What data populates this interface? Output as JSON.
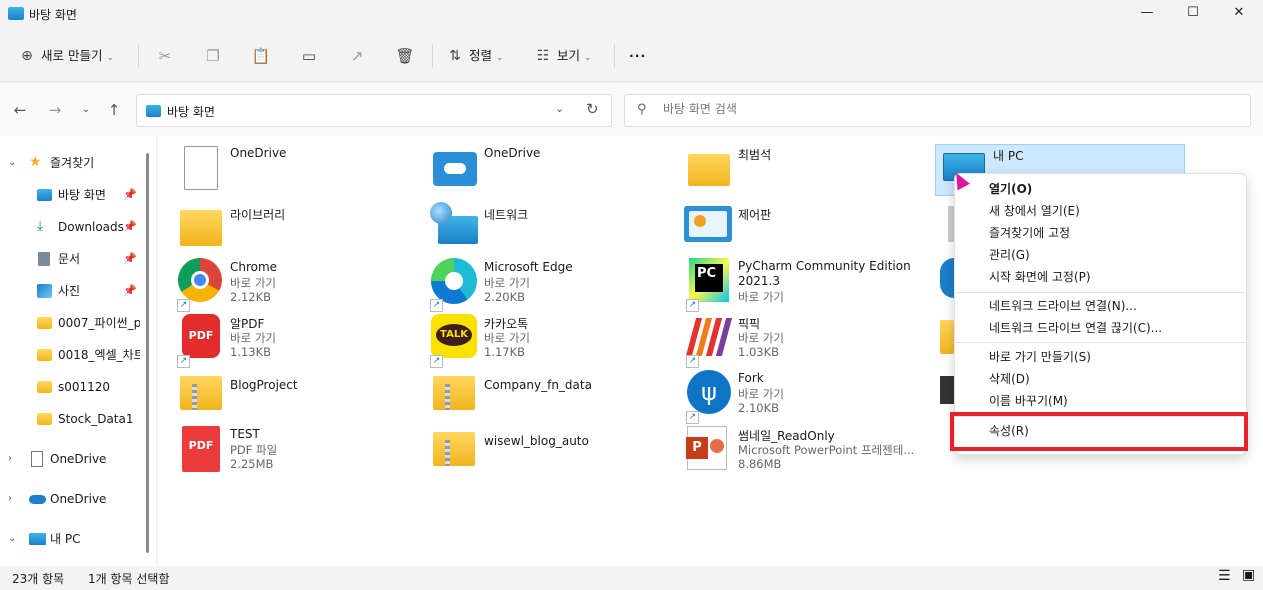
{
  "window": {
    "title": "바탕 화면",
    "min": "—",
    "max": "☐",
    "close": "✕"
  },
  "toolbar": {
    "new_label": "새로 만들기",
    "sort_label": "정렬",
    "view_label": "보기",
    "more": "···"
  },
  "address": {
    "path": "바탕 화면"
  },
  "search": {
    "placeholder": "바탕 화면 검색"
  },
  "sidebar": {
    "items": [
      {
        "label": "즐겨찾기"
      },
      {
        "label": "바탕 화면"
      },
      {
        "label": "Downloads"
      },
      {
        "label": "문서"
      },
      {
        "label": "사진"
      },
      {
        "label": "0007_파이썬_p"
      },
      {
        "label": "0018_엑셀_차트"
      },
      {
        "label": "s001120"
      },
      {
        "label": "Stock_Data1"
      },
      {
        "label": "OneDrive"
      },
      {
        "label": "OneDrive"
      },
      {
        "label": "내 PC"
      }
    ]
  },
  "files": [
    {
      "name": "OneDrive"
    },
    {
      "name": "OneDrive"
    },
    {
      "name": "최범석"
    },
    {
      "name": "내 PC"
    },
    {
      "name": "라이브러리"
    },
    {
      "name": "네트워크"
    },
    {
      "name": "제어판"
    },
    {
      "name": "Chrome",
      "type": "바로 가기",
      "size": "2.12KB"
    },
    {
      "name": "Microsoft Edge",
      "type": "바로 가기",
      "size": "2.20KB"
    },
    {
      "name": "PyCharm Community Edition",
      "name2": "2021.3",
      "type": "바로 가기"
    },
    {
      "name": "알PDF",
      "type": "바로 가기",
      "size": "1.13KB"
    },
    {
      "name": "카카오톡",
      "type": "바로 가기",
      "size": "1.17KB"
    },
    {
      "name": "픽픽",
      "type": "바로 가기",
      "size": "1.03KB"
    },
    {
      "name": "BlogProject"
    },
    {
      "name": "Company_fn_data"
    },
    {
      "name": "Fork",
      "type": "바로 가기",
      "size": "2.10KB"
    },
    {
      "name": "TEST",
      "type": "PDF 파일",
      "size": "2.25MB"
    },
    {
      "name": "wisewl_blog_auto"
    },
    {
      "name": "썸네일_ReadOnly",
      "type": "Microsoft PowerPoint 프레젠테...",
      "size": "8.86MB"
    }
  ],
  "context_menu": {
    "items": [
      "열기(O)",
      "새 창에서 열기(E)",
      "즐겨찾기에 고정",
      "관리(G)",
      "시작 화면에 고정(P)",
      "네트워크 드라이브 연결(N)...",
      "네트워크 드라이브 연결 끊기(C)...",
      "바로 가기 만들기(S)",
      "삭제(D)",
      "이름 바꾸기(M)",
      "속성(R)"
    ]
  },
  "status": {
    "count": "23개 항목",
    "selected": "1개 항목 선택함"
  },
  "colors": {
    "highlight": "#e8222a",
    "selection": "#cde8ff",
    "accent": "#1c7fc9"
  }
}
